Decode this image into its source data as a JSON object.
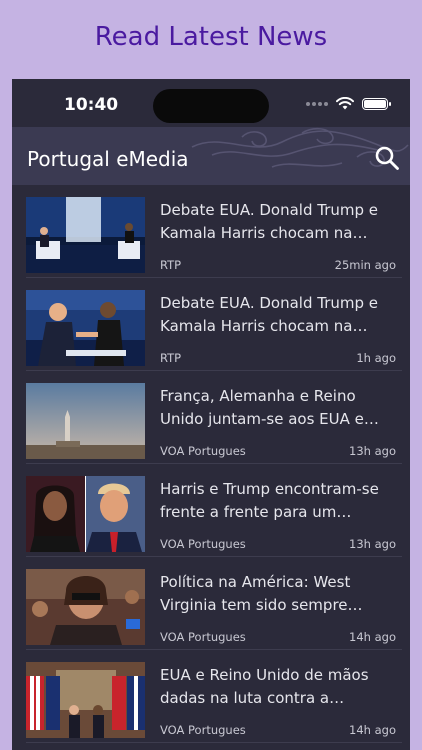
{
  "promo": {
    "title": "Read Latest News"
  },
  "status_bar": {
    "time": "10:40"
  },
  "header": {
    "title": "Portugal eMedia",
    "search_icon": "search-icon"
  },
  "news": [
    {
      "headline": "Debate EUA. Donald Trump e Kamala Harris chocam na eco...",
      "source": "RTP",
      "time": "25min ago",
      "thumb": "debate-stage"
    },
    {
      "headline": "Debate EUA. Donald Trump e Kamala Harris chocam na eco...",
      "source": "RTP",
      "time": "1h ago",
      "thumb": "handshake"
    },
    {
      "headline": "França, Alemanha e Reino Unido juntam-se aos EUA e an...",
      "source": "VOA Portugues",
      "time": "13h ago",
      "thumb": "missile"
    },
    {
      "headline": "Harris e Trump encontram-se frente a frente para um debat...",
      "source": "VOA Portugues",
      "time": "13h ago",
      "thumb": "portraits"
    },
    {
      "headline": "Política na América: West Virginia tem sido sempre favo...",
      "source": "VOA Portugues",
      "time": "14h ago",
      "thumb": "crowd"
    },
    {
      "headline": "EUA e Reino Unido de mãos dadas na luta contra a influên...",
      "source": "VOA Portugues",
      "time": "14h ago",
      "thumb": "flags"
    }
  ]
}
